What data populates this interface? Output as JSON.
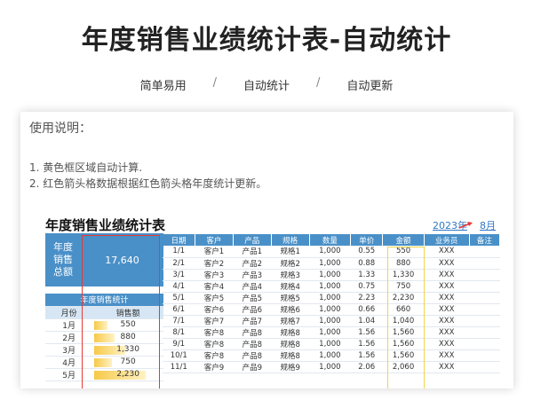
{
  "header": {
    "title": "年度销售业绩统计表-自动统计",
    "tags": [
      "简单易用",
      "自动统计",
      "自动更新"
    ],
    "separator": "/"
  },
  "instructions": {
    "title": "使用说明：",
    "lines": [
      "1. 黄色框区域自动计算.",
      "2. 红色箭头格数据根据红色箭头格年度统计更新。"
    ]
  },
  "sheet": {
    "title": "年度销售业绩统计表",
    "year": "2023年",
    "month": "8月",
    "total_label": "年度\n销售\n总额",
    "total_value": "17,640",
    "monthly": {
      "title": "年度销售统计",
      "headers": [
        "月份",
        "销售额"
      ],
      "rows": [
        {
          "month": "1月",
          "value": "550",
          "fraction": 0.25
        },
        {
          "month": "2月",
          "value": "880",
          "fraction": 0.39
        },
        {
          "month": "3月",
          "value": "1,330",
          "fraction": 0.6
        },
        {
          "month": "4月",
          "value": "750",
          "fraction": 0.34
        },
        {
          "month": "5月",
          "value": "2,230",
          "fraction": 1.0
        }
      ]
    },
    "detail": {
      "headers": [
        "日期",
        "客户",
        "产品",
        "规格",
        "数量",
        "单价",
        "金额",
        "业务员",
        "备注"
      ],
      "rows": [
        [
          "1/1",
          "客户1",
          "产品1",
          "规格1",
          "1,000",
          "0.55",
          "550",
          "XXX",
          ""
        ],
        [
          "2/1",
          "客户2",
          "产品2",
          "规格2",
          "1,000",
          "0.88",
          "880",
          "XXX",
          ""
        ],
        [
          "3/1",
          "客户3",
          "产品3",
          "规格3",
          "1,000",
          "1.33",
          "1,330",
          "XXX",
          ""
        ],
        [
          "4/1",
          "客户4",
          "产品4",
          "规格4",
          "1,000",
          "0.75",
          "750",
          "XXX",
          ""
        ],
        [
          "5/1",
          "客户5",
          "产品5",
          "规格5",
          "1,000",
          "2.23",
          "2,230",
          "XXX",
          ""
        ],
        [
          "6/1",
          "客户6",
          "产品6",
          "规格6",
          "1,000",
          "0.66",
          "660",
          "XXX",
          ""
        ],
        [
          "7/1",
          "客户7",
          "产品7",
          "规格7",
          "1,000",
          "1.04",
          "1,040",
          "XXX",
          ""
        ],
        [
          "8/1",
          "客户8",
          "产品8",
          "规格8",
          "1,000",
          "1.56",
          "1,560",
          "XXX",
          ""
        ],
        [
          "9/1",
          "客户8",
          "产品8",
          "规格8",
          "1,000",
          "1.56",
          "1,560",
          "XXX",
          ""
        ],
        [
          "10/1",
          "客户8",
          "产品8",
          "规格8",
          "1,000",
          "1.56",
          "1,560",
          "XXX",
          ""
        ],
        [
          "11/1",
          "客户9",
          "产品9",
          "规格9",
          "1,000",
          "2.06",
          "2,060",
          "XXX",
          ""
        ]
      ]
    }
  },
  "colors": {
    "header_blue": "#4a90c8",
    "highlight_red": "#e53935",
    "highlight_yellow": "#f1d44c"
  }
}
